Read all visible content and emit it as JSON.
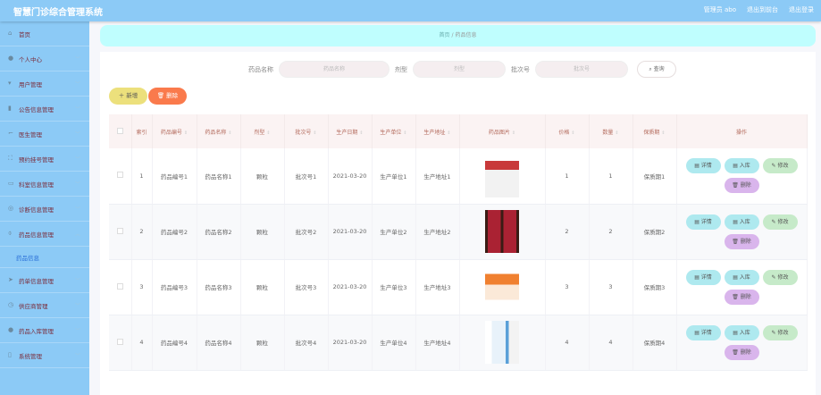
{
  "header": {
    "title": "智慧门诊综合管理系统",
    "user": "管理员 abo",
    "front": "退出到前台",
    "logout": "退出登录"
  },
  "sidebar": {
    "items": [
      {
        "label": "首页",
        "icon": "home-icon",
        "chevron": false
      },
      {
        "label": "个人中心",
        "icon": "user-icon",
        "chevron": true
      },
      {
        "label": "用户管理",
        "icon": "users-icon",
        "chevron": true
      },
      {
        "label": "公告信息管理",
        "icon": "clipboard-icon",
        "chevron": true
      },
      {
        "label": "医生管理",
        "icon": "crop-icon",
        "chevron": true
      },
      {
        "label": "预约挂号管理",
        "icon": "fullscreen-icon",
        "chevron": true
      },
      {
        "label": "科室信息管理",
        "icon": "message-icon",
        "chevron": true
      },
      {
        "label": "诊断信息管理",
        "icon": "compass-icon",
        "chevron": true
      },
      {
        "label": "药品信息管理",
        "icon": "microphone-icon",
        "chevron": true,
        "open": true
      }
    ],
    "sub": "药品信息",
    "items2": [
      {
        "label": "药单信息管理",
        "icon": "send-icon"
      },
      {
        "label": "供应商管理",
        "icon": "clock-icon"
      },
      {
        "label": "药品入库管理",
        "icon": "user-icon"
      },
      {
        "label": "系统管理",
        "icon": "mobile-icon"
      }
    ]
  },
  "breadcrumb": {
    "home": "首页",
    "sep": "/",
    "current": "药品信息"
  },
  "search": {
    "name_label": "药品名称",
    "name_placeholder": "药品名称",
    "type_label": "剂型",
    "type_placeholder": "剂型",
    "batch_label": "批次号",
    "batch_placeholder": "批次号",
    "query": "查询"
  },
  "actions": {
    "add": "新增",
    "delete": "删除"
  },
  "table": {
    "headers": [
      "索引",
      "药品编号",
      "药品名称",
      "剂型",
      "批次号",
      "生产日期",
      "生产单位",
      "生产地址",
      "药品图片",
      "价格",
      "数量",
      "保质期",
      "操作"
    ],
    "rows": [
      {
        "index": "1",
        "code": "药品编号1",
        "name": "药品名称1",
        "type": "颗粒",
        "batch": "批次号1",
        "date": "2021-03-20",
        "unit": "生产单位1",
        "addr": "生产地址1",
        "price": "1",
        "qty": "1",
        "shelf": "保质期1"
      },
      {
        "index": "2",
        "code": "药品编号2",
        "name": "药品名称2",
        "type": "颗粒",
        "batch": "批次号2",
        "date": "2021-03-20",
        "unit": "生产单位2",
        "addr": "生产地址2",
        "price": "2",
        "qty": "2",
        "shelf": "保质期2"
      },
      {
        "index": "3",
        "code": "药品编号3",
        "name": "药品名称3",
        "type": "颗粒",
        "batch": "批次号3",
        "date": "2021-03-20",
        "unit": "生产单位3",
        "addr": "生产地址3",
        "price": "3",
        "qty": "3",
        "shelf": "保质期3"
      },
      {
        "index": "4",
        "code": "药品编号4",
        "name": "药品名称4",
        "type": "颗粒",
        "batch": "批次号4",
        "date": "2021-03-20",
        "unit": "生产单位4",
        "addr": "生产地址4",
        "price": "4",
        "qty": "4",
        "shelf": "保质期4"
      }
    ],
    "row_buttons": {
      "detail": "详情",
      "stock": "入库",
      "edit": "修改",
      "delete": "删除"
    }
  },
  "colors": {
    "header": "#8ccaf6",
    "crumb": "#bffefe",
    "add": "#ece07c",
    "del": "#fa7a4c"
  }
}
